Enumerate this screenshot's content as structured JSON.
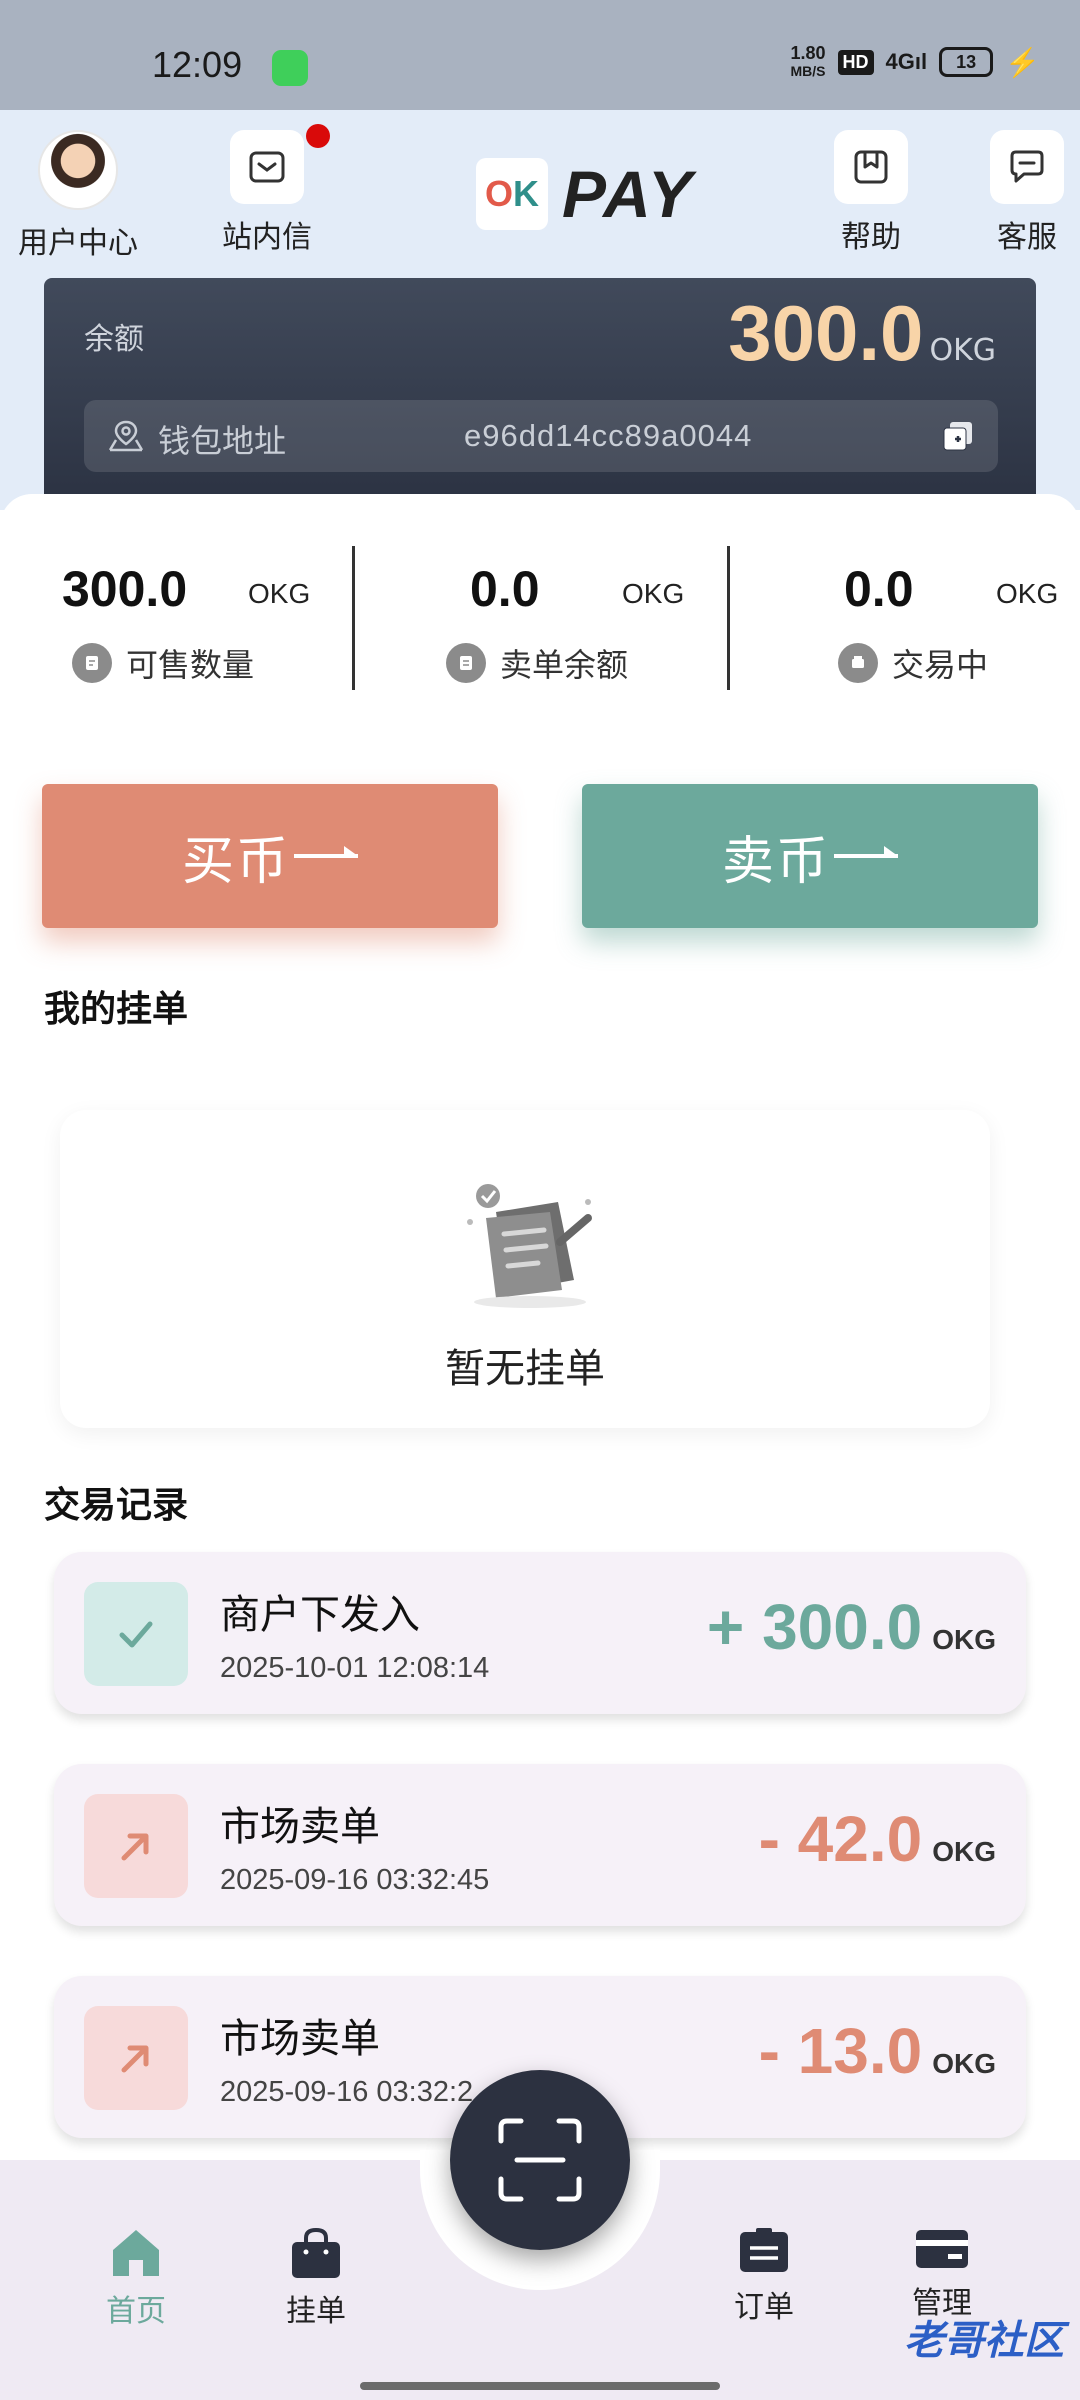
{
  "status_bar": {
    "time": "12:09",
    "speed_top": "1.80",
    "speed_bottom": "MB/S",
    "hd": "HD",
    "signal": "4G",
    "battery": "13"
  },
  "header": {
    "user_center": "用户中心",
    "inbox": "站内信",
    "logo_text": "PAY",
    "help": "帮助",
    "support": "客服"
  },
  "balance": {
    "label": "余额",
    "amount": "300.0",
    "unit": "OKG",
    "wallet_label": "钱包地址",
    "wallet_address": "e96dd14cc89a0044"
  },
  "stats": [
    {
      "value": "300.0",
      "unit": "OKG",
      "label": "可售数量"
    },
    {
      "value": "0.0",
      "unit": "OKG",
      "label": "卖单余额"
    },
    {
      "value": "0.0",
      "unit": "OKG",
      "label": "交易中"
    }
  ],
  "actions": {
    "buy": "买币",
    "sell": "卖币"
  },
  "my_orders": {
    "title": "我的挂单",
    "empty": "暂无挂单"
  },
  "records": {
    "title": "交易记录",
    "items": [
      {
        "title": "商户下发入",
        "time": "2025-10-01 12:08:14",
        "amount": "+ 300.0",
        "unit": "OKG",
        "direction": "in"
      },
      {
        "title": "市场卖单",
        "time": "2025-09-16 03:32:45",
        "amount": "- 42.0",
        "unit": "OKG",
        "direction": "out"
      },
      {
        "title": "市场卖单",
        "time": "2025-09-16 03:32:2",
        "amount": "- 13.0",
        "unit": "OKG",
        "direction": "out"
      }
    ]
  },
  "bottom_nav": {
    "home": "首页",
    "orders_listing": "挂单",
    "orders": "订单",
    "manage": "管理"
  },
  "watermark": "老哥社区",
  "colors": {
    "buy": "#df8b74",
    "sell": "#6ca99c",
    "card_dark": "#2c3343",
    "balance_gold": "#f8d4a8"
  }
}
